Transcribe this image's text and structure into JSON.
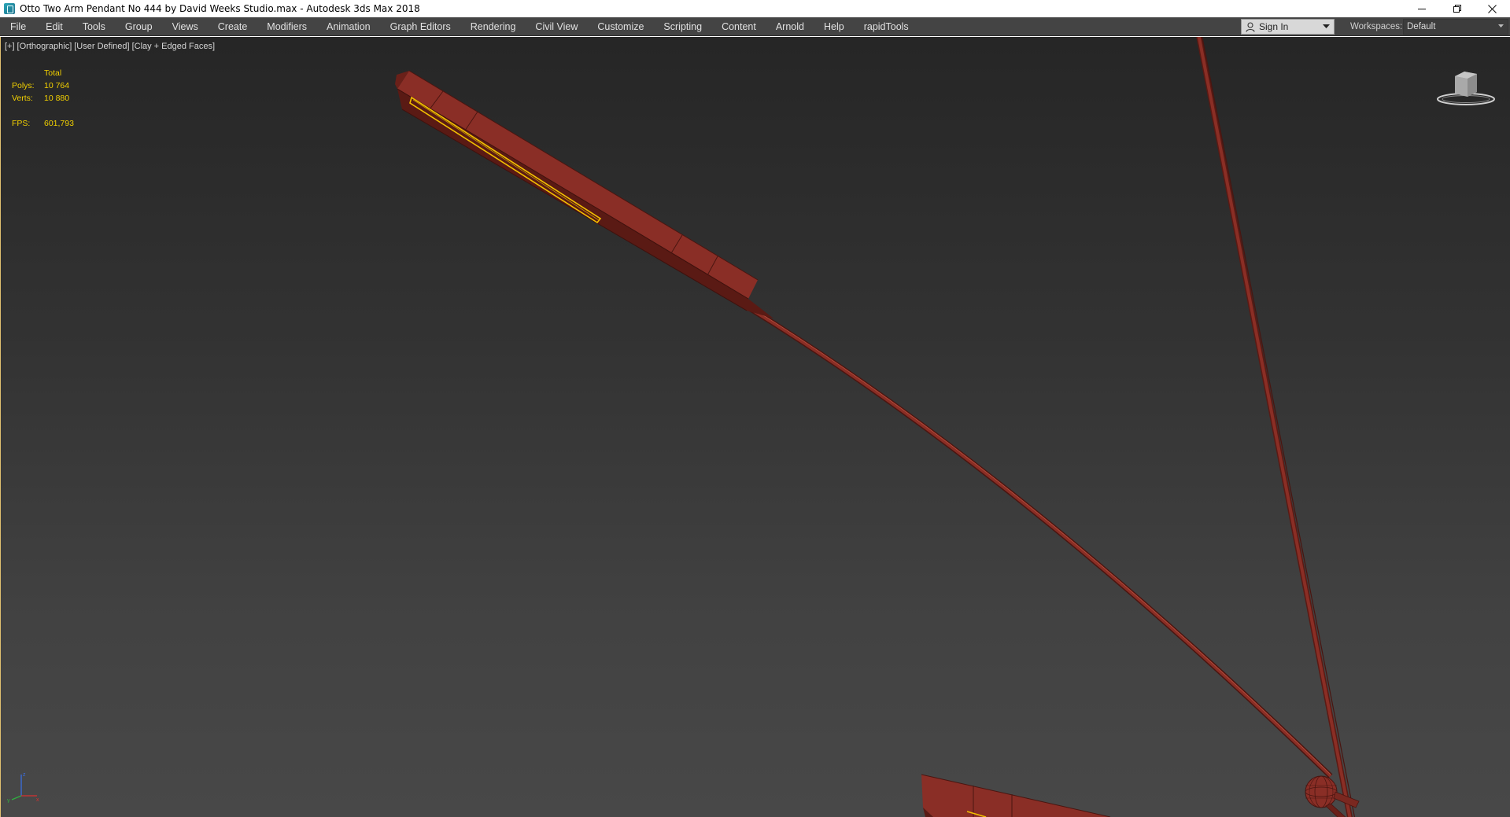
{
  "window": {
    "title": "Otto Two Arm Pendant No 444 by David Weeks Studio.max - Autodesk 3ds Max 2018",
    "icon": "3ds-max-app-icon",
    "controls": {
      "minimize": "minimize-icon",
      "restore": "restore-icon",
      "close": "close-icon"
    }
  },
  "menubar": {
    "items": [
      {
        "label": "File"
      },
      {
        "label": "Edit"
      },
      {
        "label": "Tools"
      },
      {
        "label": "Group"
      },
      {
        "label": "Views"
      },
      {
        "label": "Create"
      },
      {
        "label": "Modifiers"
      },
      {
        "label": "Animation"
      },
      {
        "label": "Graph Editors"
      },
      {
        "label": "Rendering"
      },
      {
        "label": "Civil View"
      },
      {
        "label": "Customize"
      },
      {
        "label": "Scripting"
      },
      {
        "label": "Content"
      },
      {
        "label": "Arnold"
      },
      {
        "label": "Help"
      },
      {
        "label": "rapidTools"
      }
    ],
    "sign_in": "Sign In",
    "workspaces_label": "Workspaces:",
    "workspaces_value": "Default"
  },
  "viewport": {
    "labels": [
      "[+]",
      "[Orthographic]",
      "[User Defined]",
      "[Clay + Edged Faces]"
    ],
    "stats": {
      "header": "Total",
      "polys_label": "Polys:",
      "polys_value": "10 764",
      "verts_label": "Verts:",
      "verts_value": "10 880",
      "fps_label": "FPS:",
      "fps_value": "601,793"
    },
    "colors": {
      "background_top": "#262626",
      "background_bottom": "#484848",
      "model_clay": "#7a2a22",
      "model_edges": "#4a1510",
      "selection_highlight": "#f2c000",
      "stats_text": "#f2d000"
    }
  }
}
